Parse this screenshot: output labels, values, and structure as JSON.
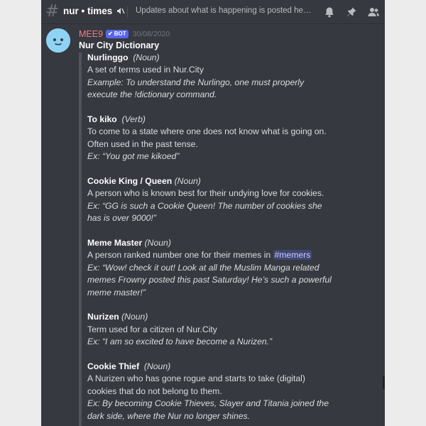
{
  "header": {
    "channel_name": "nur • times",
    "topic": "Updates about what is happening is posted here. nur..."
  },
  "message": {
    "author": "MEE9",
    "bot_badge": "BOT",
    "timestamp": "30/08/2020",
    "embed_title": "Nur City Dictionary",
    "entries": [
      {
        "term": "Nurlinggo",
        "pos": "(Noun)",
        "definition": [
          "A set of terms used in Nur.City"
        ],
        "example": [
          "Example: To understand the Nurlingo, one must properly",
          "execute the !dictionary command."
        ]
      },
      {
        "term": "To kiko",
        "pos": "(Verb)",
        "definition": [
          "To come to a state where one does not know what is going on.",
          "Often used in the past tense."
        ],
        "example": [
          "Ex: “You got me kikoed”"
        ]
      },
      {
        "term": "Cookie King / Queen",
        "pos": "(Noun)",
        "definition": [
          "A person who is known best for their undying love for cookies."
        ],
        "example": [
          "Ex: “GG is such a Cookie Queen!  The number of cookies she",
          "has is over 9000!”"
        ]
      },
      {
        "term": "Meme Master",
        "pos": "(Noun)",
        "definition_prefix": "A person ranked number one for their memes in ",
        "mention": "#memers",
        "example": [
          "Ex: “Wow! check it out! Look at all the Muslim Manga related",
          "memes Frowny posted this past Saturday! He’s such a powerful",
          "meme master!”"
        ]
      },
      {
        "term": "Nurizen",
        "pos": "(Noun)",
        "definition": [
          "Term used for a citizen of Nur.City"
        ],
        "example": [
          "Ex: “I am so excited to have become a Nurizen.”"
        ]
      },
      {
        "term": "Cookie Thief",
        "pos": "(Noun)",
        "definition": [
          "A Nurizen who has gone rogue and starts to take (digital)",
          "cookies that do not belong to them."
        ],
        "example": [
          "Ex: By becoming Cookie Thieves, Slayer and Titania joined the",
          "dark side, where the Nur no longer shines."
        ]
      }
    ]
  },
  "colors": {
    "background": "#36393f",
    "author": "#f47b85",
    "bot_badge": "#5865f2",
    "mention_bg": "#414675"
  },
  "icons": [
    "hash-icon",
    "deafen-icon",
    "bell-icon",
    "pin-icon",
    "members-icon",
    "avatar-icon"
  ]
}
